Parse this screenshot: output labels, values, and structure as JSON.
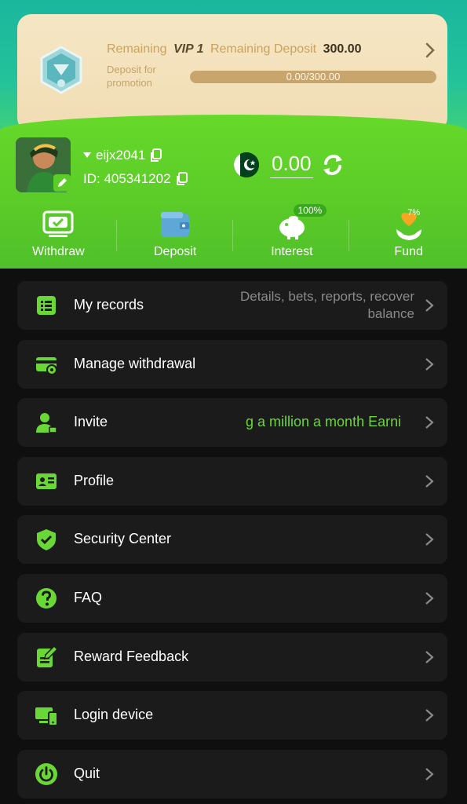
{
  "vip": {
    "remaining_label": "Remaining",
    "level": "VIP 1",
    "remaining_deposit_label": "Remaining Deposit",
    "remaining_deposit_amount": "300.00",
    "subtitle": "Deposit for promotion",
    "progress_text": "0.00/300.00",
    "progress_value": 0
  },
  "user": {
    "username": "eijx2041",
    "id_text": "ID: 405341202",
    "balance": "0.00",
    "currency_flag": "pakistan-flag"
  },
  "quick_actions": [
    {
      "label": "Withdraw",
      "icon": "withdraw-icon"
    },
    {
      "label": "Deposit",
      "icon": "wallet-icon"
    },
    {
      "label": "Interest",
      "icon": "piggy-bank-icon",
      "badge": "100%"
    },
    {
      "label": "Fund",
      "icon": "fund-icon",
      "badge": "7%"
    }
  ],
  "menu": [
    {
      "label": "My records",
      "hint": "Details, bets, reports, recover balance",
      "icon": "records-icon"
    },
    {
      "label": "Manage withdrawal",
      "icon": "card-icon"
    },
    {
      "label": "Invite",
      "marquee": "g a million a month  Earni",
      "icon": "invite-icon"
    },
    {
      "label": "Profile",
      "icon": "profile-card-icon"
    },
    {
      "label": "Security Center",
      "icon": "shield-icon"
    },
    {
      "label": "FAQ",
      "icon": "question-icon"
    },
    {
      "label": "Reward Feedback",
      "icon": "feedback-icon"
    },
    {
      "label": "Login device",
      "icon": "devices-icon"
    },
    {
      "label": "Quit",
      "icon": "power-icon"
    }
  ],
  "colors": {
    "accent_green": "#5ccc28",
    "vip_card": "#f3e2bd",
    "menu_bg": "#1b1b1b"
  }
}
